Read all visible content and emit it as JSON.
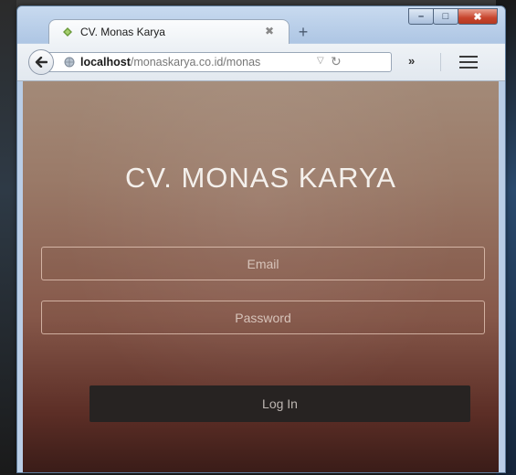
{
  "browser": {
    "tab": {
      "title": "CV. Monas Karya",
      "close_glyph": "✖",
      "favicon": "leaf-diamond-icon"
    },
    "new_tab_glyph": "+",
    "url": {
      "host": "localhost",
      "path": "/monaskarya.co.id/monas"
    },
    "overflow_glyph": "»",
    "window_controls": {
      "minimize": "–",
      "maximize": "□",
      "close": "✖"
    }
  },
  "page": {
    "title": "CV. MONAS KARYA",
    "email_placeholder": "Email",
    "password_placeholder": "Password",
    "login_label": "Log In"
  },
  "colors": {
    "background_top": "#a38a78",
    "background_bottom": "#3a1c18",
    "button": "#272322",
    "field_border": "#ebcdbe"
  }
}
